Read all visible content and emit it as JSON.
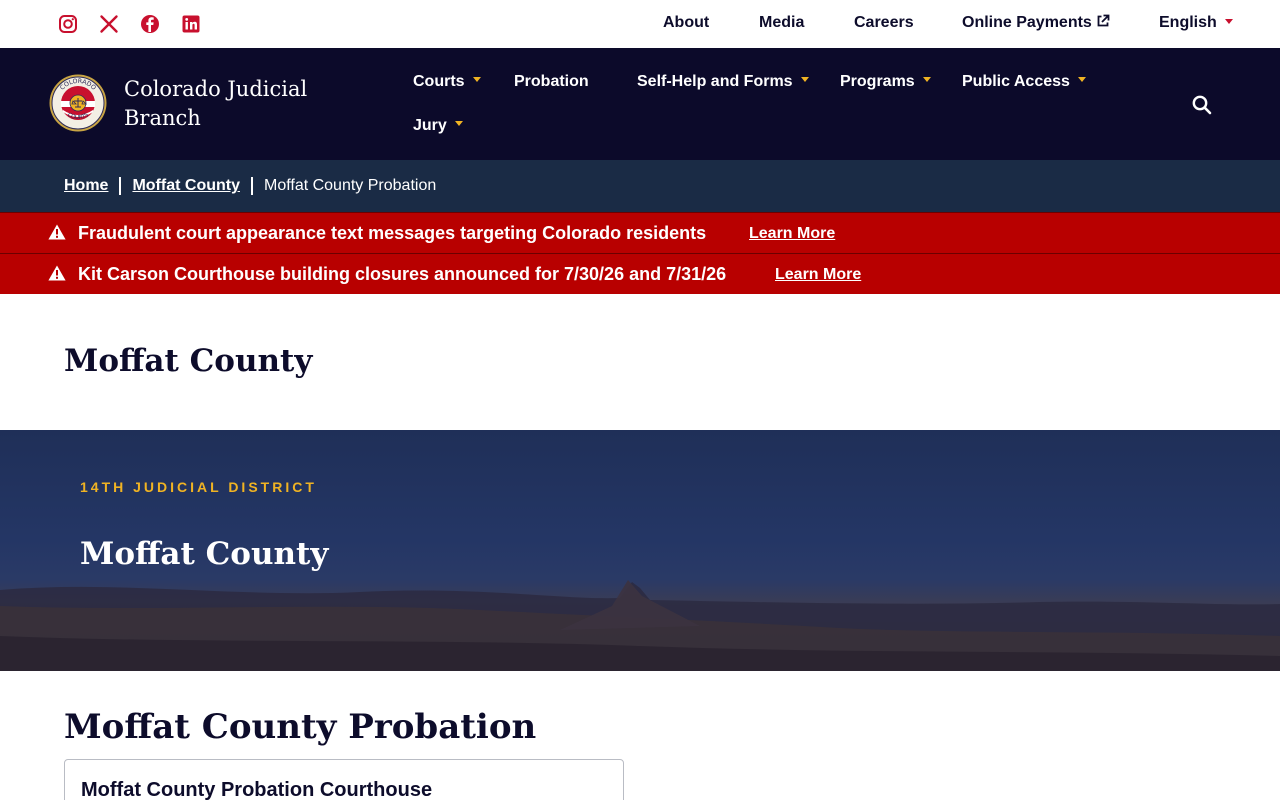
{
  "utility_bar": {
    "social_icons": [
      "instagram-icon",
      "x-icon",
      "facebook-icon",
      "linkedin-icon"
    ],
    "links": {
      "about": "About",
      "media": "Media",
      "careers": "Careers",
      "online_payments": "Online Payments",
      "language": "English"
    }
  },
  "header": {
    "brand_line1": "Colorado Judicial",
    "brand_line2": "Branch",
    "seal_text_top": "COLORADO",
    "seal_text_bottom": "COURTS",
    "nav": {
      "courts": "Courts",
      "probation": "Probation",
      "self_help": "Self-Help and Forms",
      "programs": "Programs",
      "public_access": "Public Access",
      "jury": "Jury"
    }
  },
  "breadcrumb": {
    "home": "Home",
    "county": "Moffat County",
    "current": "Moffat County Probation"
  },
  "alerts": [
    {
      "message": "Fraudulent court appearance text messages targeting Colorado residents",
      "link": "Learn More"
    },
    {
      "message": "Kit Carson Courthouse building closures announced for 7/30/26 and 7/31/26",
      "link": "Learn More"
    }
  ],
  "page": {
    "title": "Moffat County"
  },
  "hero": {
    "eyebrow": "14TH JUDICIAL DISTRICT",
    "title": "Moffat County"
  },
  "section": {
    "title": "Moffat County Probation",
    "card_title": "Moffat County Probation Courthouse"
  },
  "colors": {
    "navy": "#0c0a2a",
    "breadcrumb": "#1a2b45",
    "alert_red": "#b80000",
    "accent_gold": "#f0b323",
    "social_red": "#c8102e"
  }
}
